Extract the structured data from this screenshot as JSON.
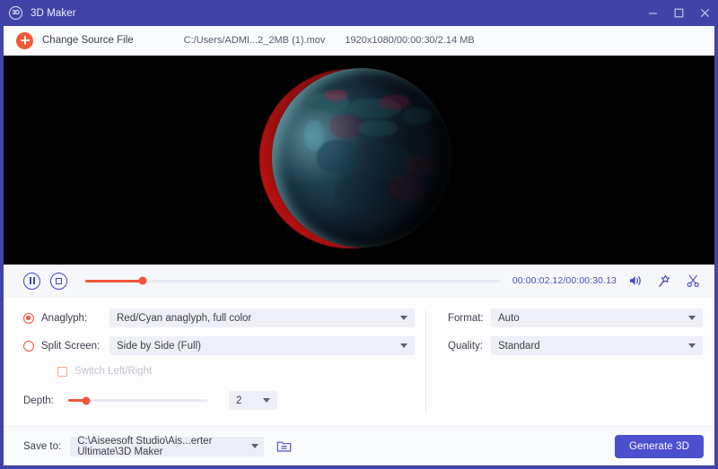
{
  "window": {
    "title": "3D Maker",
    "logo_text": "3D",
    "controls": {
      "minimize": "minimize-icon",
      "maximize": "maximize-icon",
      "close": "close-icon"
    }
  },
  "source_bar": {
    "add_icon": "plus-circle-icon",
    "change_source_label": "Change Source File",
    "file_path": "C:/Users/ADMI...2_2MB (1).mov",
    "file_meta": "1920x1080/00:00:30/2.14 MB"
  },
  "preview": {
    "content": "anaglyph-3d-earth-globe"
  },
  "player": {
    "pause_icon": "pause-icon",
    "stop_icon": "stop-icon",
    "progress_percent": 13.8,
    "time": "00:00:02.12/00:00:30.13",
    "volume_icon": "volume-icon",
    "effect_icon": "magic-wand-icon",
    "cut_icon": "scissors-icon"
  },
  "options": {
    "anaglyph": {
      "label": "Anaglyph:",
      "selected": true,
      "value": "Red/Cyan anaglyph, full color"
    },
    "split_screen": {
      "label": "Split Screen:",
      "selected": false,
      "value": "Side by Side (Full)"
    },
    "switch_lr": {
      "label": "Switch Left/Right",
      "checked": false,
      "disabled": true
    },
    "depth": {
      "label": "Depth:",
      "slider_percent": 13,
      "value": "2"
    },
    "format": {
      "label": "Format:",
      "value": "Auto"
    },
    "quality": {
      "label": "Quality:",
      "value": "Standard"
    }
  },
  "bottom": {
    "save_to_label": "Save to:",
    "save_to_path": "C:\\Aiseesoft Studio\\Ais...erter Ultimate\\3D Maker",
    "folder_icon": "folder-open-icon",
    "generate_label": "Generate 3D"
  },
  "colors": {
    "brand_purple": "#3f44a6",
    "accent_orange": "#f1563a",
    "button_indigo": "#4b50cf"
  }
}
